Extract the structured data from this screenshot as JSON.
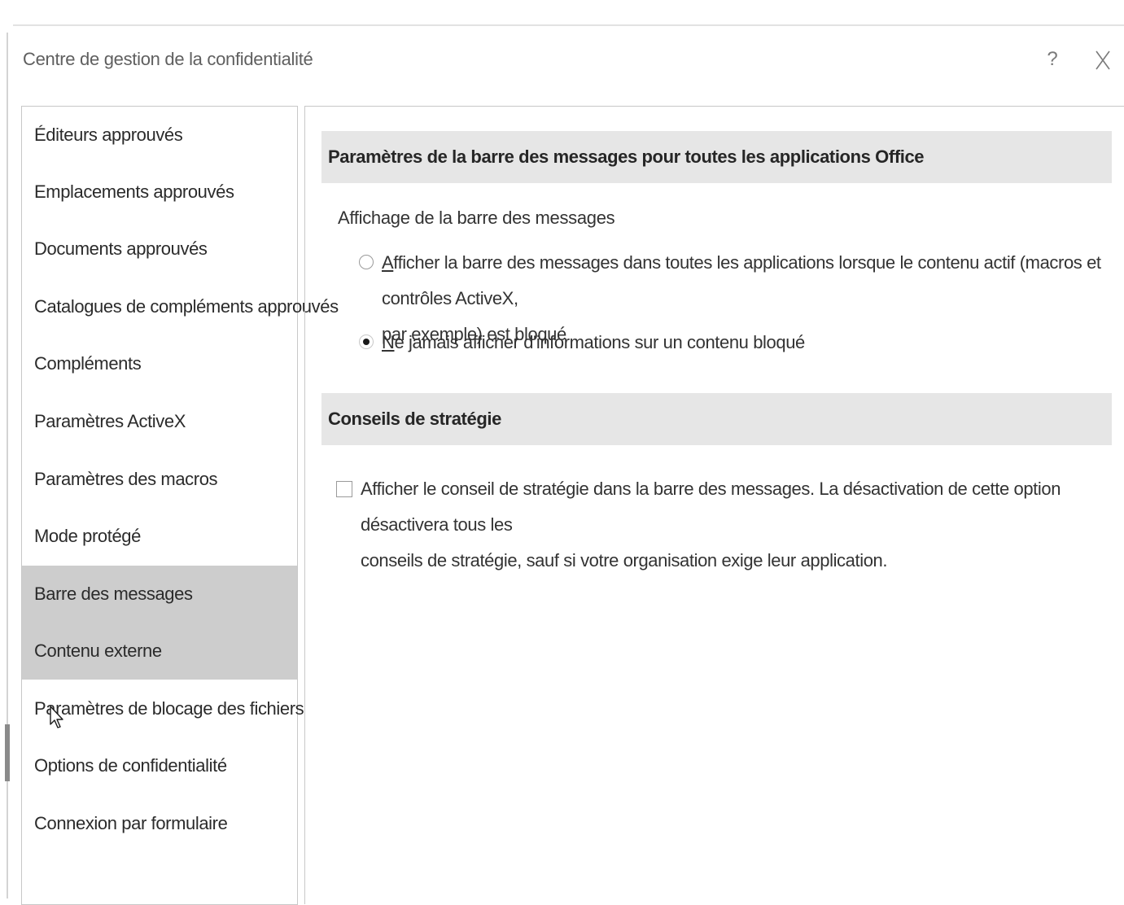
{
  "dialog": {
    "title": "Centre de gestion de la confidentialité",
    "help_label": "?",
    "close_icon": "close-icon"
  },
  "sidebar": {
    "items": [
      {
        "label": "Éditeurs approuvés",
        "selected": false
      },
      {
        "label": "Emplacements approuvés",
        "selected": false
      },
      {
        "label": "Documents approuvés",
        "selected": false
      },
      {
        "label": "Catalogues de compléments approuvés",
        "selected": false
      },
      {
        "label": "Compléments",
        "selected": false
      },
      {
        "label": "Paramètres ActiveX",
        "selected": false
      },
      {
        "label": "Paramètres des macros",
        "selected": false
      },
      {
        "label": "Mode protégé",
        "selected": false
      },
      {
        "label": "Barre des messages",
        "selected": true
      },
      {
        "label": "Contenu externe",
        "selected": false,
        "hovered": true
      },
      {
        "label": "Paramètres de blocage des fichiers",
        "selected": false
      },
      {
        "label": "Options de confidentialité",
        "selected": false
      },
      {
        "label": "Connexion par formulaire",
        "selected": false
      }
    ]
  },
  "main": {
    "section1": {
      "header": "Paramètres de la barre des messages pour toutes les applications Office",
      "group_label": "Affichage de la barre des messages",
      "options": [
        {
          "mnemonic": "A",
          "line1_rest": "fficher la barre des messages dans toutes les applications lorsque le contenu actif (macros et contrôles ActiveX,",
          "line2": "par exemple) est bloqué",
          "checked": false
        },
        {
          "mnemonic": "N",
          "line1_rest": "e jamais afficher d'informations sur un contenu bloqué",
          "checked": true
        }
      ]
    },
    "section2": {
      "header": "Conseils de stratégie",
      "checkbox": {
        "line1": "Afficher le conseil de stratégie dans la barre des messages. La désactivation de cette option désactivera tous les",
        "line2": "conseils de stratégie, sauf si votre organisation exige leur application.",
        "checked": false
      }
    }
  },
  "cursor": {
    "icon": "mouse-pointer-icon"
  }
}
